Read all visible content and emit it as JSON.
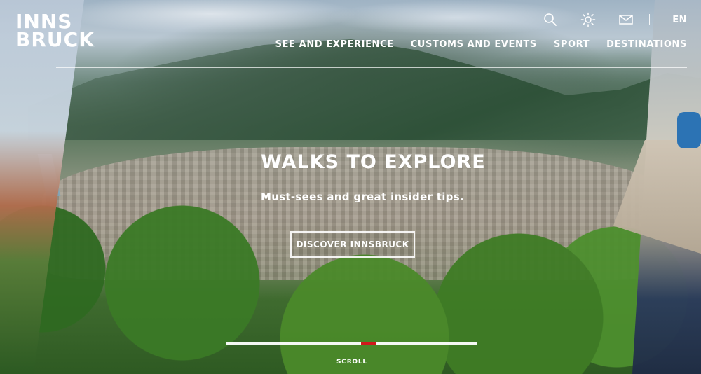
{
  "brand": {
    "logo_line1": "INNS",
    "logo_line2": "BRUCK"
  },
  "header": {
    "language": "EN",
    "icons": [
      "search-icon",
      "sun-icon",
      "mail-icon"
    ]
  },
  "nav": {
    "items": [
      {
        "label": "SEE AND EXPERIENCE"
      },
      {
        "label": "CUSTOMS AND EVENTS"
      },
      {
        "label": "SPORT"
      },
      {
        "label": "DESTINATIONS"
      }
    ]
  },
  "hero": {
    "title": "WALKS TO EXPLORE",
    "subtitle": "Must-sees and great insider tips.",
    "cta_label": "DISCOVER INNSBRUCK"
  },
  "slider": {
    "progress_percent": 6,
    "scroll_label": "SCROLL"
  },
  "colors": {
    "accent_red": "#d1181c"
  }
}
